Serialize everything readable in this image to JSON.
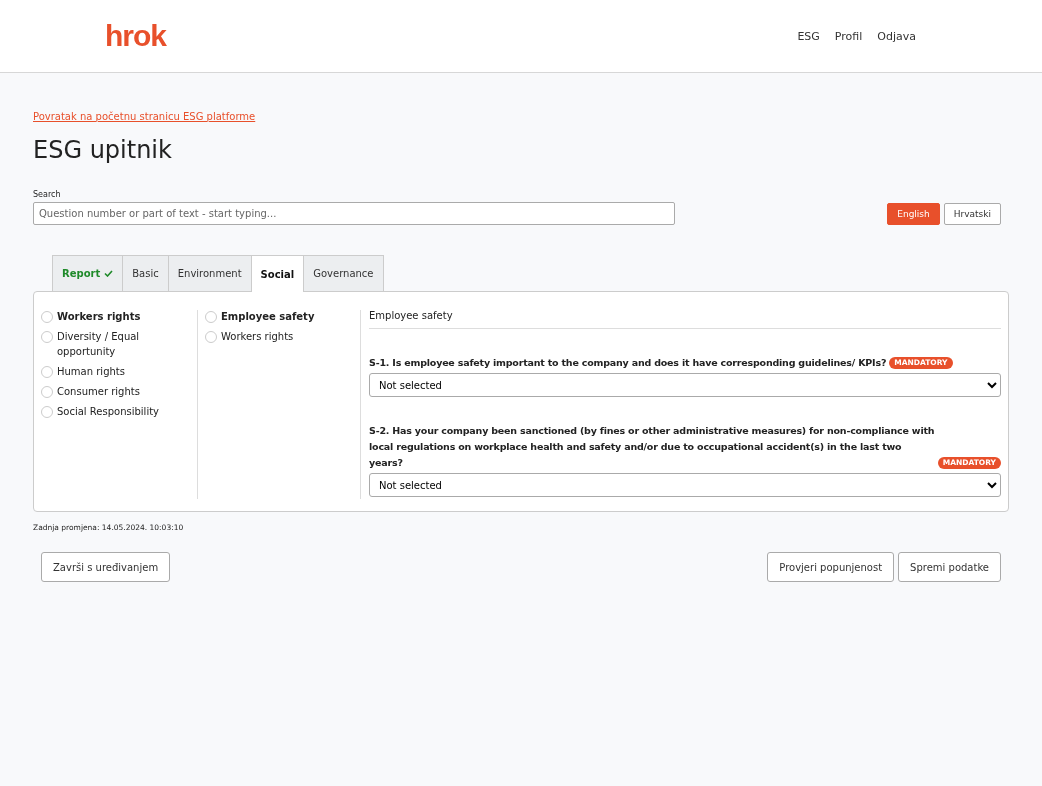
{
  "header": {
    "logo": "hrok",
    "nav": [
      "ESG",
      "Profil",
      "Odjava"
    ]
  },
  "back_link": "Povratak na početnu stranicu ESG platforme",
  "title": "ESG upitnik",
  "search": {
    "label": "Search",
    "placeholder": "Question number or part of text - start typing..."
  },
  "languages": [
    {
      "label": "English",
      "selected": true
    },
    {
      "label": "Hrvatski",
      "selected": false
    }
  ],
  "tabs": [
    {
      "label": "Report",
      "selected": false,
      "completed": true
    },
    {
      "label": "Basic",
      "selected": false,
      "completed": false
    },
    {
      "label": "Environment",
      "selected": false,
      "completed": false
    },
    {
      "label": "Social",
      "selected": true,
      "completed": false
    },
    {
      "label": "Governance",
      "selected": false,
      "completed": false
    }
  ],
  "categories": [
    {
      "label": "Workers rights",
      "selected": true,
      "checked": false
    },
    {
      "label": "Diversity / Equal opportunity",
      "selected": false,
      "checked": false
    },
    {
      "label": "Human rights",
      "selected": false,
      "checked": false
    },
    {
      "label": "Consumer rights",
      "selected": false,
      "checked": false
    },
    {
      "label": "Social Responsibility",
      "selected": false,
      "checked": false
    }
  ],
  "subcategories": [
    {
      "label": "Employee safety",
      "selected": true,
      "checked": false
    },
    {
      "label": "Workers rights",
      "selected": false,
      "checked": false
    }
  ],
  "section_title": "Employee safety",
  "questions": [
    {
      "text": "S-1. Is employee safety important to the company and does it have corresponding guidelines/ KPIs?",
      "badge": "MANDATORY",
      "value": "Not selected"
    },
    {
      "text": "S-2. Has your company been sanctioned (by fines or other administrative measures) for non-compliance with local regulations on workplace health and safety and/or due to occupational accident(s) in the last two years?",
      "badge": "MANDATORY",
      "value": "Not selected"
    }
  ],
  "last_change": "Zadnja promjena: 14.05.2024. 10:03:10",
  "buttons": {
    "left": [
      "Završi s uređivanjem"
    ],
    "right": [
      "Provjeri popunjenost",
      "Spremi podatke"
    ]
  }
}
